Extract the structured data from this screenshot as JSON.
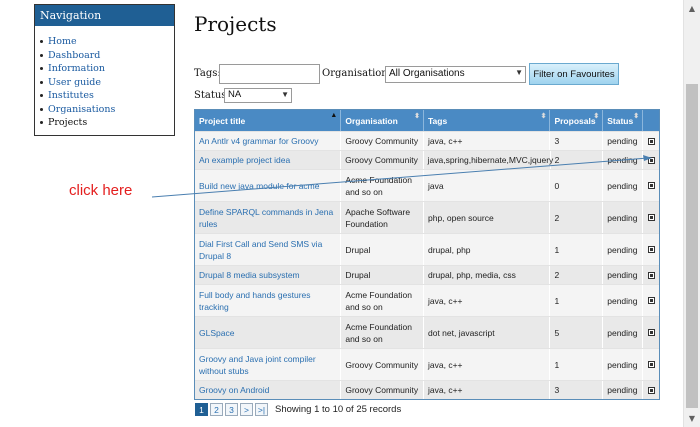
{
  "nav": {
    "title": "Navigation",
    "items": [
      {
        "label": "Home",
        "current": false
      },
      {
        "label": "Dashboard",
        "current": false
      },
      {
        "label": "Information",
        "current": false
      },
      {
        "label": "User guide",
        "current": false
      },
      {
        "label": "Institutes",
        "current": false
      },
      {
        "label": "Organisations",
        "current": false
      },
      {
        "label": "Projects",
        "current": true
      }
    ]
  },
  "page": {
    "title": "Projects"
  },
  "filters": {
    "tags_label": "Tags:",
    "tags_value": "",
    "org_label": "Organisations:",
    "org_value": "All Organisations",
    "favourites_button": "Filter on Favourites",
    "status_label": "Status:",
    "status_value": "NA"
  },
  "table": {
    "headers": [
      "Project title",
      "Organisation",
      "Tags",
      "Proposals",
      "Status"
    ],
    "rows": [
      {
        "title": "An Antlr v4 grammar for Groovy",
        "org": "Groovy Community",
        "tags": "java, c++",
        "proposals": "3",
        "status": "pending",
        "h": 19
      },
      {
        "title": "An example project idea",
        "org": "Groovy Community",
        "tags": "java,spring,hibernate,MVC,jquery",
        "proposals": "2",
        "status": "pending",
        "h": 19
      },
      {
        "title": "Build new java module for acme",
        "org": "Acme Foundation and so on",
        "tags": "java",
        "proposals": "0",
        "status": "pending",
        "h": 32
      },
      {
        "title": "Define SPARQL commands in Jena rules",
        "org": "Apache Software Foundation",
        "tags": "php, open source",
        "proposals": "2",
        "status": "pending",
        "h": 32
      },
      {
        "title": "Dial First Call and Send SMS via Drupal 8",
        "org": "Drupal",
        "tags": "drupal, php",
        "proposals": "1",
        "status": "pending",
        "h": 32
      },
      {
        "title": "Drupal 8 media subsystem",
        "org": "Drupal",
        "tags": "drupal, php, media, css",
        "proposals": "2",
        "status": "pending",
        "h": 19
      },
      {
        "title": "Full body and hands gestures tracking",
        "org": "Acme Foundation and so on",
        "tags": "java, c++",
        "proposals": "1",
        "status": "pending",
        "h": 32
      },
      {
        "title": "GLSpace",
        "org": "Acme Foundation and so on",
        "tags": "dot net, javascript",
        "proposals": "5",
        "status": "pending",
        "h": 32
      },
      {
        "title": "Groovy and Java joint compiler without stubs",
        "org": "Groovy Community",
        "tags": "java, c++",
        "proposals": "1",
        "status": "pending",
        "h": 32
      },
      {
        "title": "Groovy on Android",
        "org": "Groovy Community",
        "tags": "java, c++",
        "proposals": "3",
        "status": "pending",
        "h": 19
      }
    ]
  },
  "pager": {
    "buttons": [
      {
        "label": "1",
        "active": true
      },
      {
        "label": "2",
        "active": false
      },
      {
        "label": "3",
        "active": false
      },
      {
        "label": ">",
        "active": false
      },
      {
        "label": ">|",
        "active": false
      }
    ],
    "info": "Showing 1 to 10 of 25 records"
  },
  "annotation": {
    "text": "click here",
    "color": "#e41e1e"
  },
  "icons": {
    "edit": "edit-icon",
    "sort_up": "sort-up-icon",
    "sort_both": "sort-icon"
  }
}
